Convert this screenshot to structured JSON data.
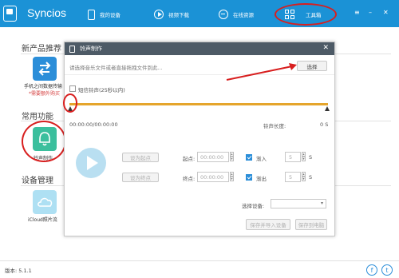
{
  "app": {
    "title": "Syncios"
  },
  "nav": [
    {
      "label": "我的设备",
      "icon": "phone-icon"
    },
    {
      "label": "视频下载",
      "icon": "play-icon"
    },
    {
      "label": "在线资源",
      "icon": "globe-icon"
    },
    {
      "label": "工具箱",
      "icon": "toolbox-icon"
    }
  ],
  "window_controls": {
    "menu": "≡",
    "minimize": "–",
    "close": "✕"
  },
  "left_panel": {
    "new_products_title": "新产品推荐",
    "transfer_app_label": "手机之间数据传输",
    "transfer_app_sub": "*需要额外购买",
    "common_title": "常用功能",
    "ringtone_label": "铃声制作",
    "device_title": "设备管理",
    "icloud_label": "iCloud照片流"
  },
  "dialog": {
    "title": "铃声制作",
    "close": "✕",
    "file_placeholder": "请选择音乐文件或者直接拖拽文件到此...",
    "select_button": "选择",
    "short_ringtone_label": "短信铃声(25秒以内)",
    "time_display": "00:00:00/00:00:00",
    "ringtone_length_label": "铃声长度:",
    "ringtone_length_value": "0 S",
    "set_start_button": "设为起点",
    "set_end_button": "设为终点",
    "start_label": "起点:",
    "end_label": "终点:",
    "start_value": "00:00:00",
    "end_value": "00:00:00",
    "fade_in_label": "渐入",
    "fade_out_label": "渐出",
    "fade_in_value": "5",
    "fade_out_value": "5",
    "seconds_unit": "S",
    "device_select_label": "选择设备:",
    "import_device_button": "保存并导入设备",
    "save_pc_button": "保存到电脑"
  },
  "footer": {
    "version": "版本: 5.1.1"
  },
  "colors": {
    "topbar": "#1b92d6",
    "dialog_header": "#4d5a66",
    "accent": "#2b8ed9",
    "annotation": "#d81f1f",
    "track": "#e5a52c"
  }
}
